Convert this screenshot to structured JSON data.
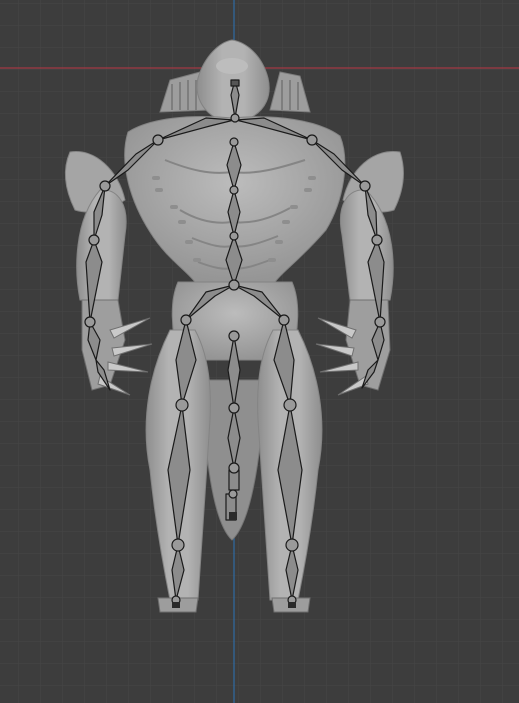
{
  "viewport": {
    "colors": {
      "background": "#3d3d3d",
      "grid_minor": "#474747",
      "grid_major": "#525252",
      "axis_x": "#a33a44",
      "axis_z": "#2f6aa3",
      "mesh": "#a9a9a9",
      "mesh_shadow": "#7a7a7a",
      "bone_fill": "#8c8c8c",
      "bone_outline": "#1a1a1a"
    },
    "object": "creature-armature-mesh"
  }
}
